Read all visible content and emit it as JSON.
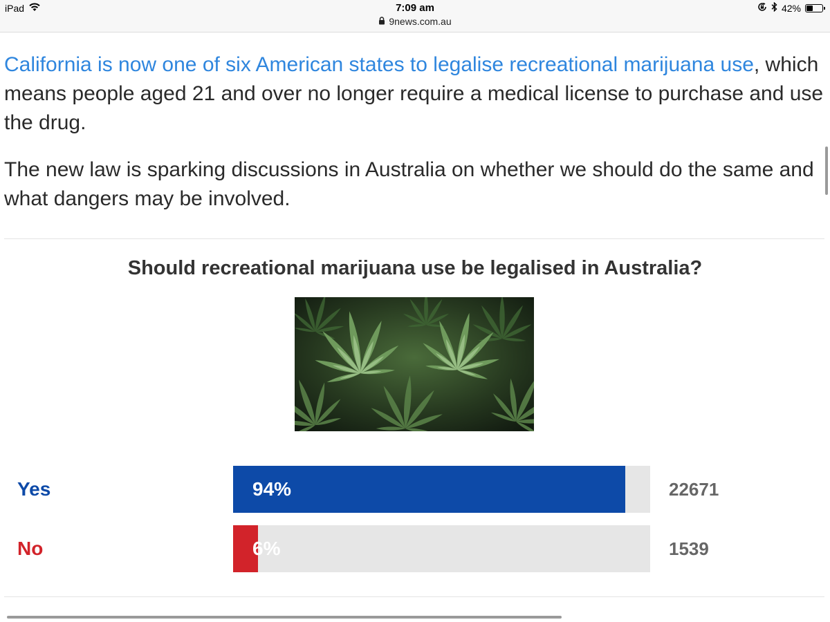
{
  "status_bar": {
    "device": "iPad",
    "time": "7:09 am",
    "url": "9news.com.au",
    "battery": "42%",
    "battery_level": 0.42,
    "icons": [
      "wifi-icon",
      "lock-icon",
      "rotation-lock-icon",
      "bluetooth-icon",
      "battery-icon"
    ]
  },
  "article": {
    "p1_link": "California is now one of six American states to legalise recreational marijuana use",
    "p1_rest": ", which means people aged 21 and over no longer require a medical license to purchase and use the drug.",
    "p2": "The new law is sparking discussions in Australia on whether we should do the same and what dangers may be involved."
  },
  "poll": {
    "question": "Should recreational marijuana use be legalised in Australia?",
    "options": [
      {
        "label": "Yes",
        "percent_label": "94%",
        "percent": 94,
        "votes": "22671",
        "color": "#0d4aa8"
      },
      {
        "label": "No",
        "percent_label": "6%",
        "percent": 6,
        "votes": "1539",
        "color": "#d2232a"
      }
    ]
  }
}
